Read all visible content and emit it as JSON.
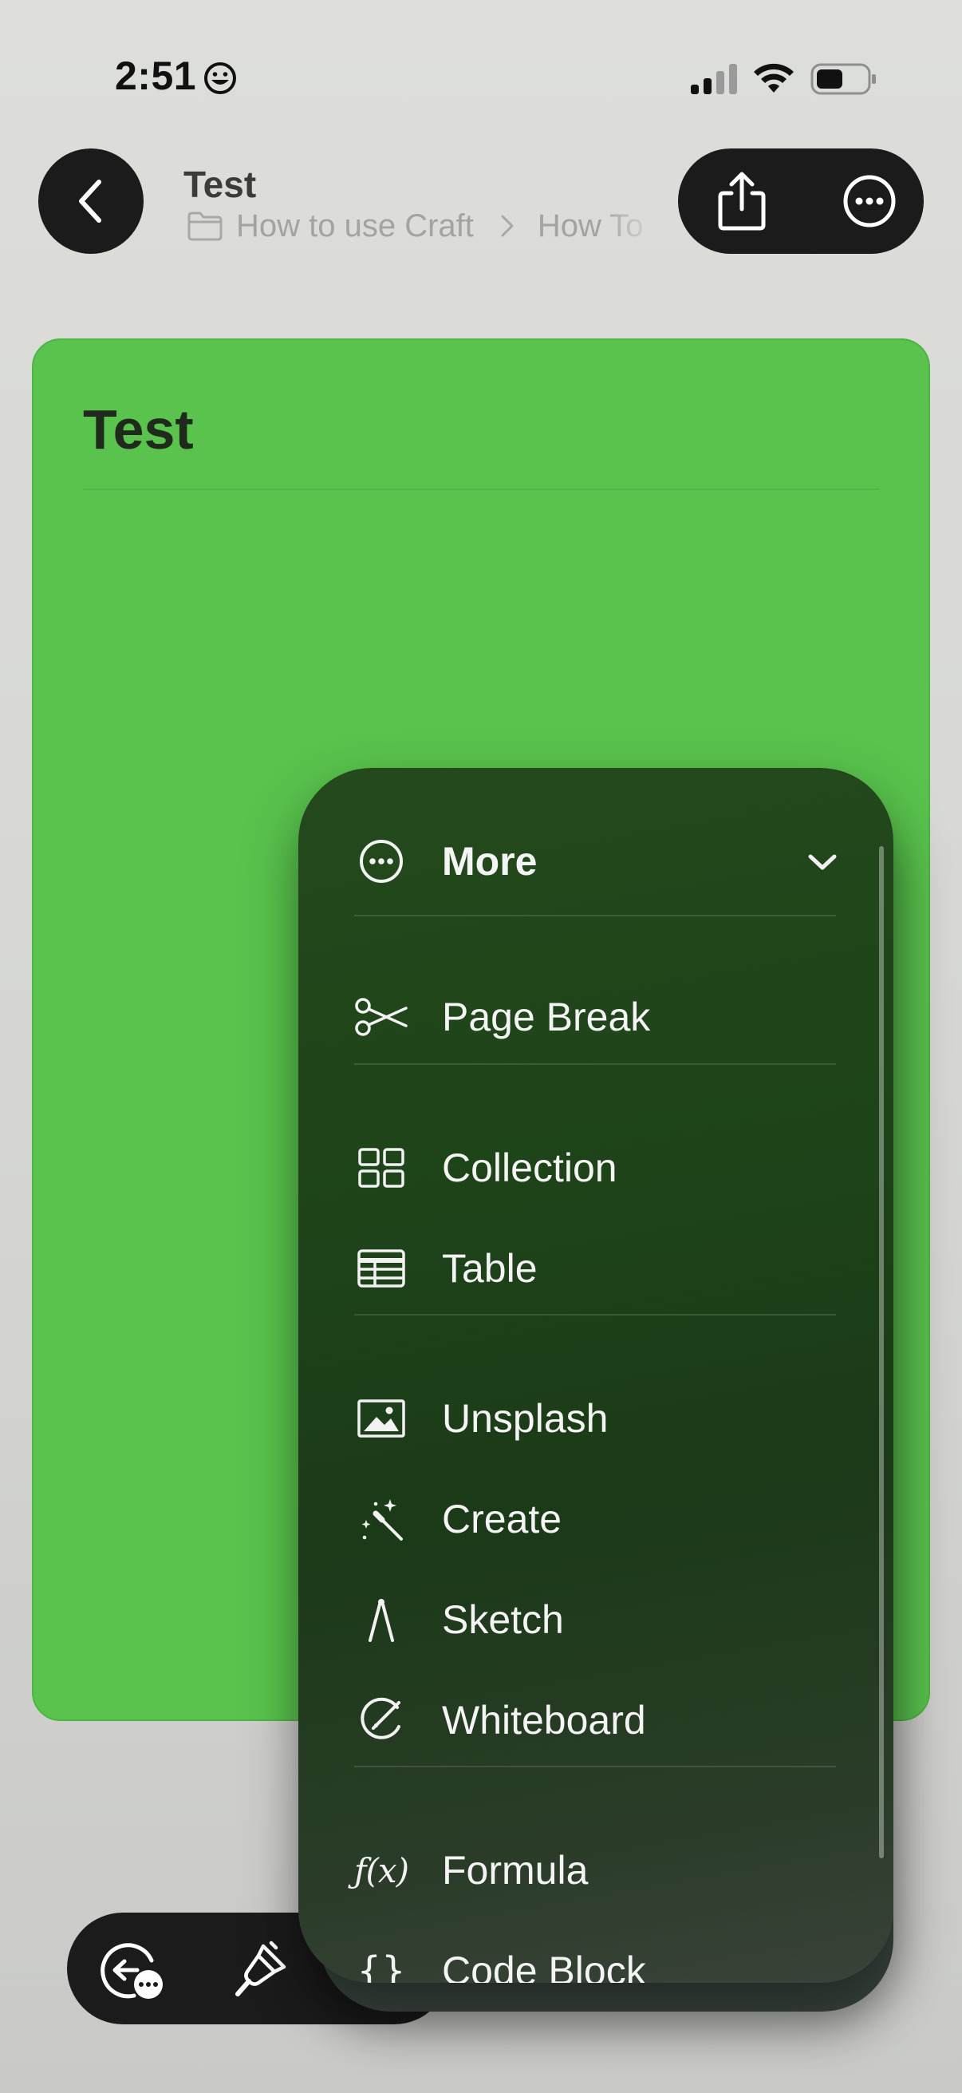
{
  "status_bar": {
    "time": "2:51",
    "emoji_icon": "grinning-face-icon",
    "signal_icon": "cellular-signal-icon",
    "wifi_icon": "wifi-icon",
    "battery_icon": "battery-icon"
  },
  "header": {
    "back_icon": "chevron-left-icon",
    "title": "Test",
    "breadcrumb": {
      "folder_icon": "folder-icon",
      "items": [
        "How to use Craft",
        "How To"
      ]
    },
    "share_icon": "share-icon",
    "more_icon": "ellipsis-circle-icon"
  },
  "document": {
    "title": "Test",
    "background_color": "#59c34d"
  },
  "menu": {
    "header": {
      "label": "More",
      "icon": "ellipsis-circle-icon",
      "chevron": "chevron-down-icon"
    },
    "items": [
      {
        "label": "Page Break",
        "icon": "scissors-icon"
      },
      {
        "label": "Collection",
        "icon": "grid-icon"
      },
      {
        "label": "Table",
        "icon": "table-icon"
      },
      {
        "label": "Unsplash",
        "icon": "photo-icon"
      },
      {
        "label": "Create",
        "icon": "magic-wand-icon"
      },
      {
        "label": "Sketch",
        "icon": "compass-icon"
      },
      {
        "label": "Whiteboard",
        "icon": "whiteboard-icon"
      },
      {
        "label": "Formula",
        "icon": "function-icon",
        "glyph": "ƒ(x)"
      },
      {
        "label": "Code Block",
        "icon": "braces-icon",
        "glyph": "{}"
      }
    ]
  },
  "toolbar": {
    "undo_icon": "undo-comment-icon",
    "brush_icon": "paintbrush-icon"
  }
}
